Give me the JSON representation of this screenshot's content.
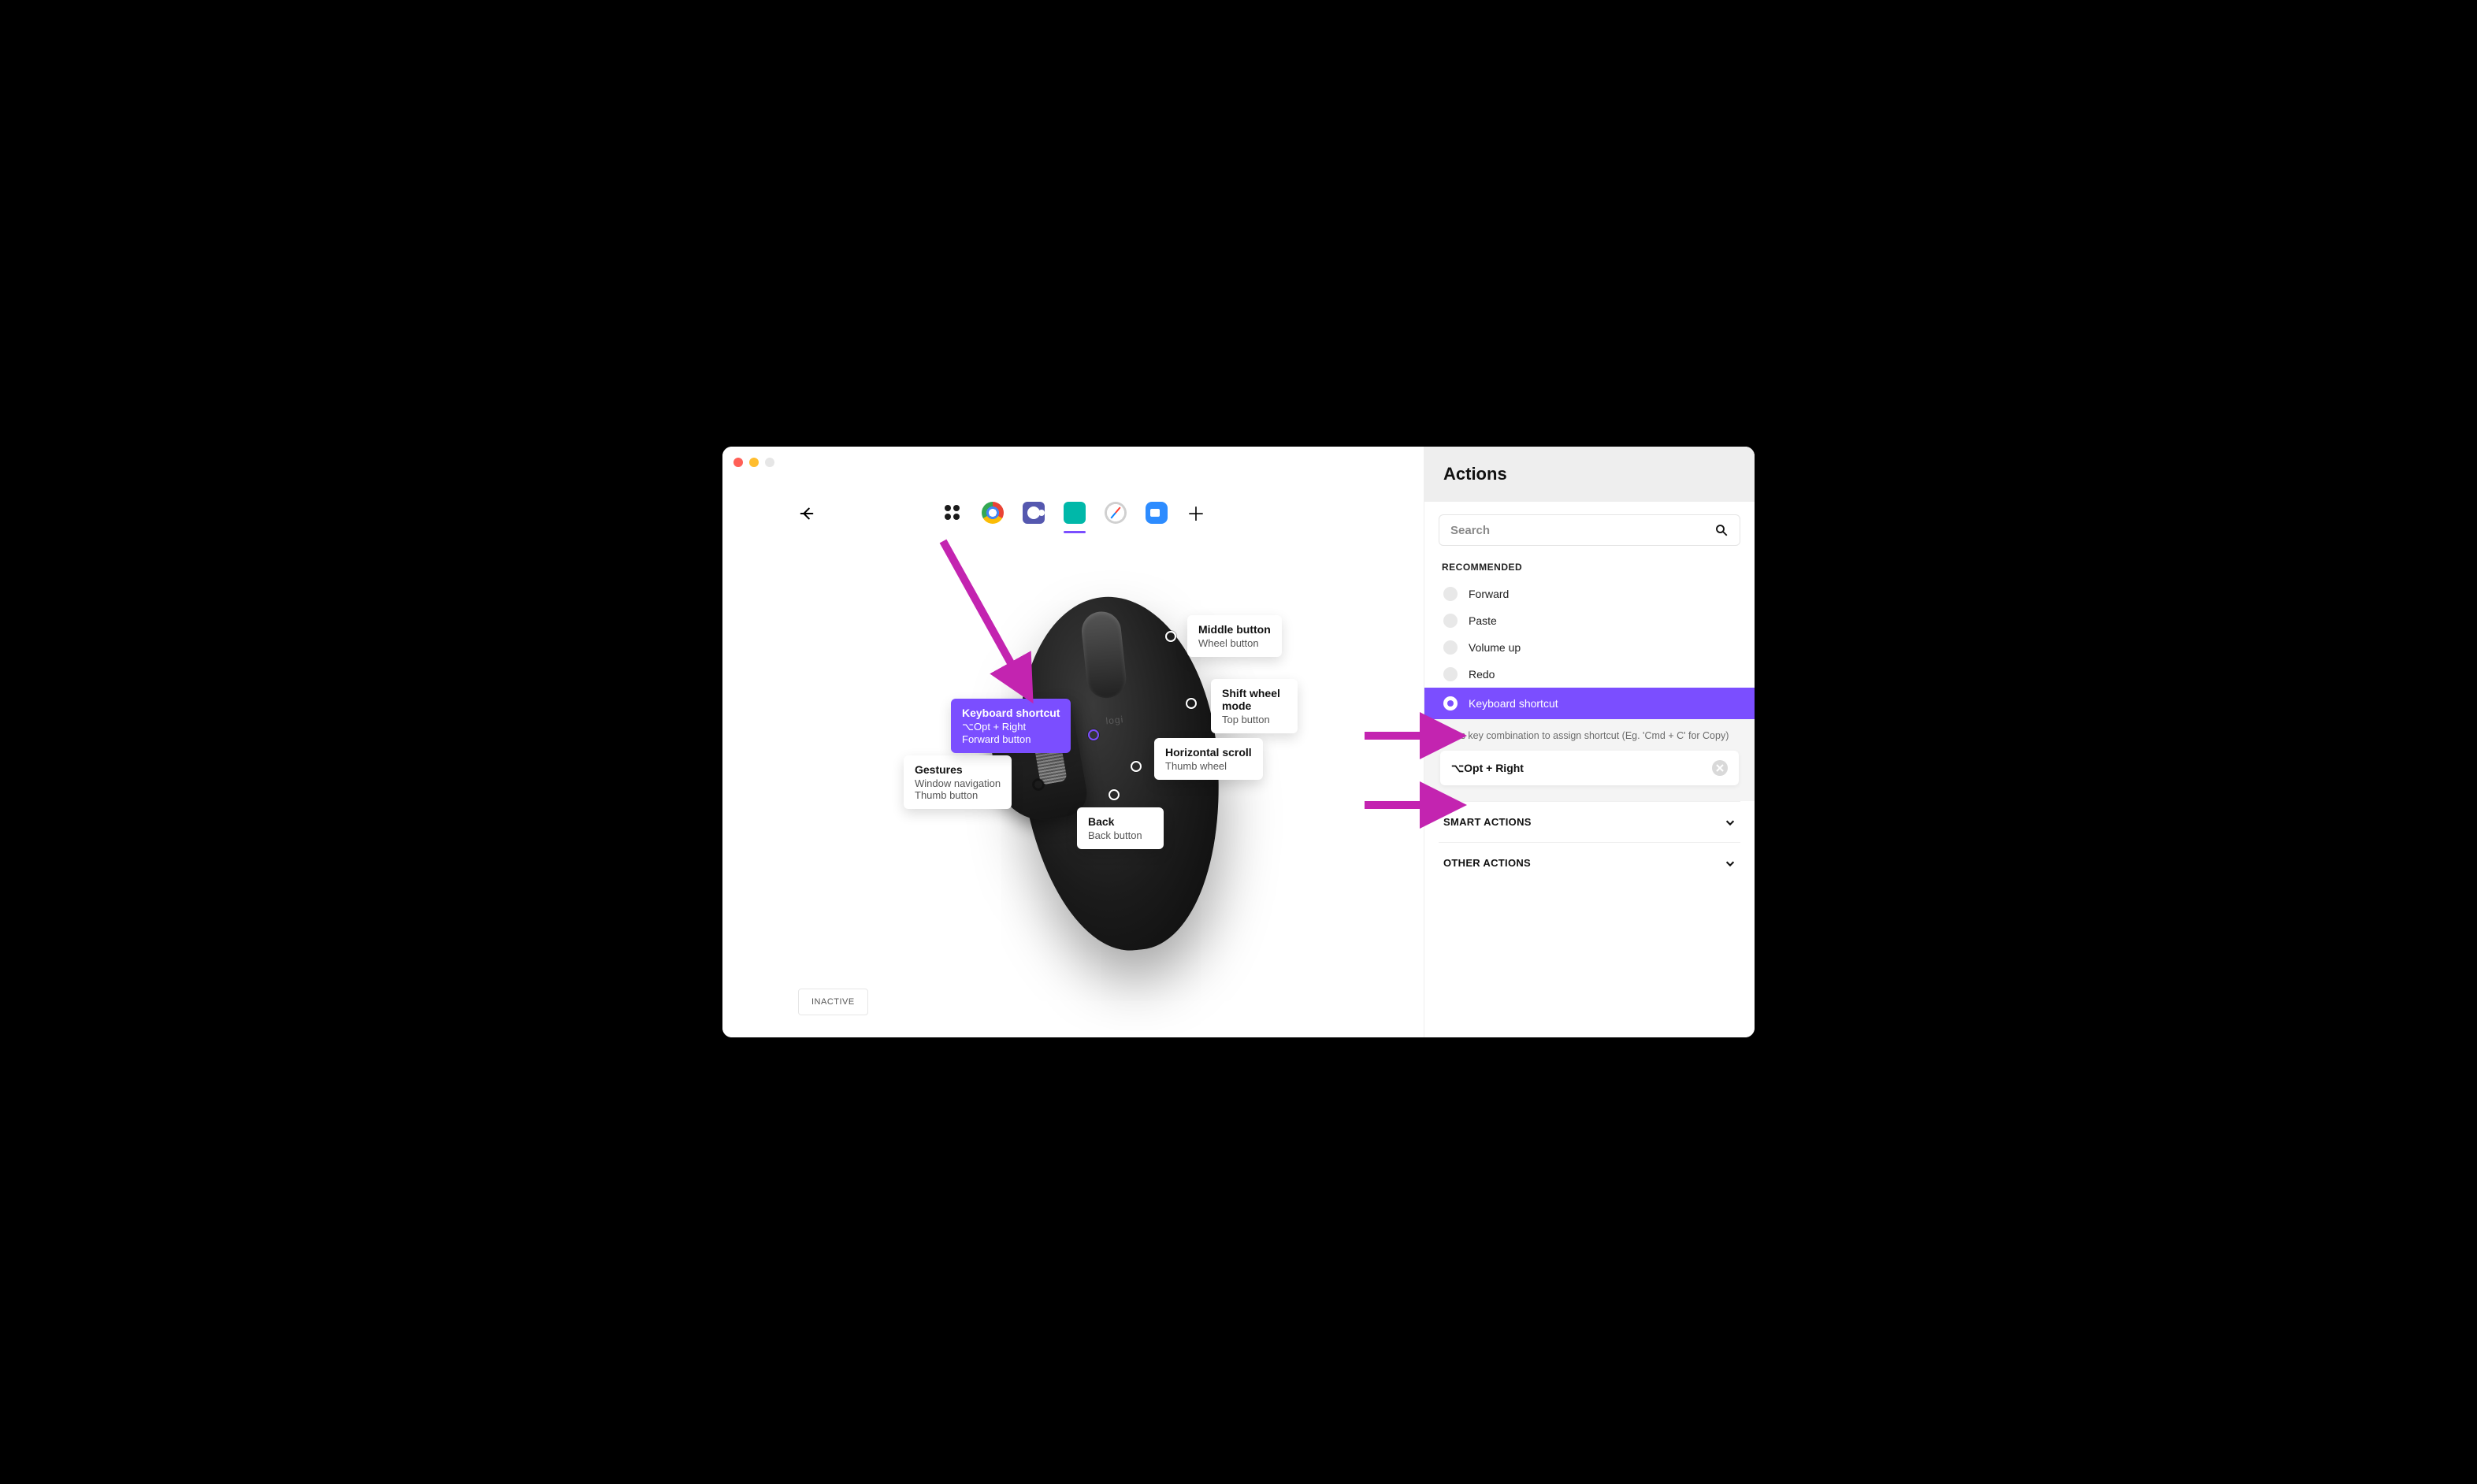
{
  "sidebar": {
    "title": "Actions",
    "search_placeholder": "Search",
    "recommended_header": "RECOMMENDED",
    "items": [
      {
        "label": "Forward"
      },
      {
        "label": "Paste"
      },
      {
        "label": "Volume up"
      },
      {
        "label": "Redo"
      },
      {
        "label": "Keyboard shortcut"
      }
    ],
    "shortcut_hint": "Press key combination to assign shortcut (Eg. 'Cmd + C' for Copy)",
    "shortcut_value": "⌥Opt + Right",
    "smart_header": "SMART ACTIONS",
    "other_header": "OTHER ACTIONS"
  },
  "buttons": {
    "middle": {
      "title": "Middle button",
      "sub": "Wheel button"
    },
    "shift": {
      "title": "Shift wheel mode",
      "sub": "Top button"
    },
    "hscroll": {
      "title": "Horizontal scroll",
      "sub": "Thumb wheel"
    },
    "back": {
      "title": "Back",
      "sub": "Back button"
    },
    "gest": {
      "title": "Gestures",
      "sub": "Window navigation",
      "sub2": "Thumb button"
    },
    "fwd": {
      "title": "Keyboard shortcut",
      "sub": "⌥Opt + Right",
      "sub2": "Forward button"
    }
  },
  "inactive_label": "INACTIVE",
  "apps": [
    "grid",
    "chrome",
    "teams",
    "logi",
    "safari",
    "zoom"
  ]
}
